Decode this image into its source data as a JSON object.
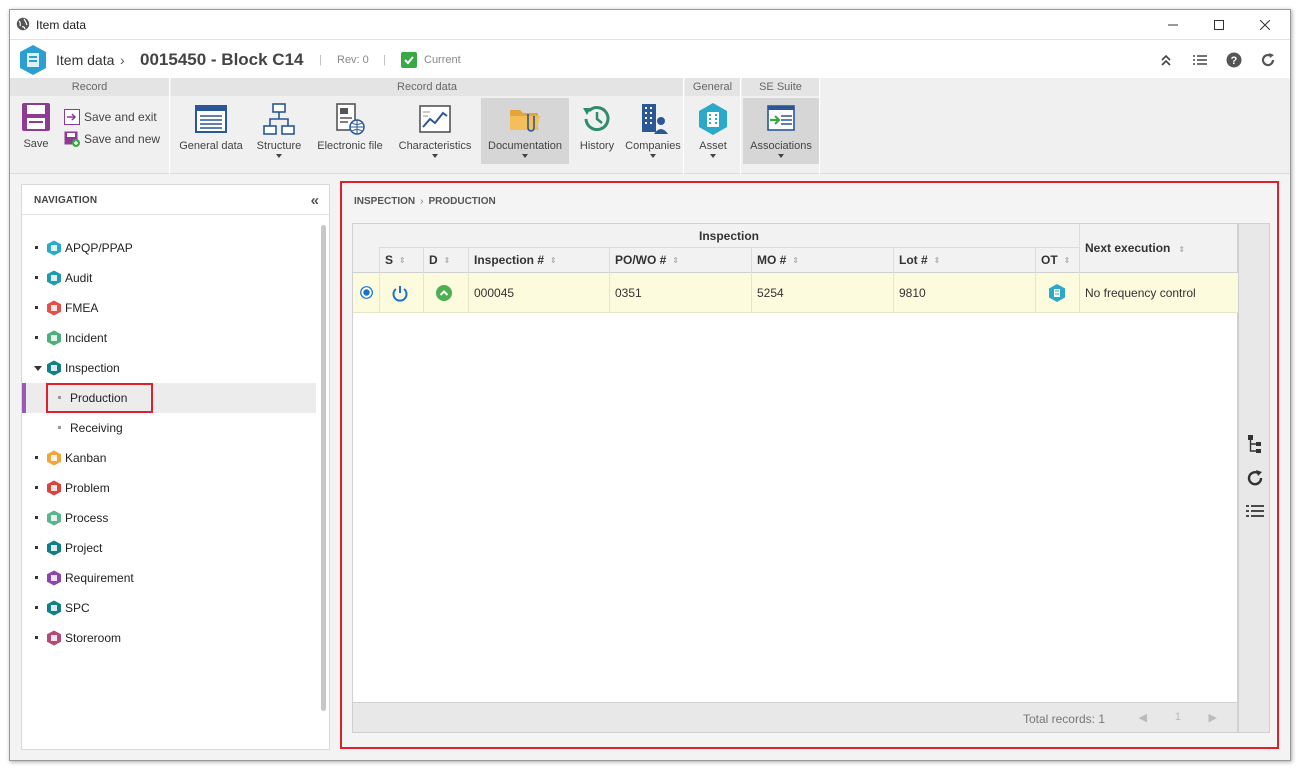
{
  "window": {
    "title": "Item data"
  },
  "header": {
    "crumb": "Item data",
    "record_title": "0015450 - Block C14",
    "separator": "|",
    "revision": "Rev: 0",
    "status": "Current"
  },
  "ribbon": {
    "groups": {
      "record": "Record",
      "record_data": "Record data",
      "general": "General",
      "se_suite": "SE Suite"
    },
    "buttons": {
      "save": "Save",
      "save_exit": "Save and exit",
      "save_new": "Save and new",
      "general_data": "General data",
      "structure": "Structure",
      "electronic_file": "Electronic file",
      "characteristics": "Characteristics",
      "documentation": "Documentation",
      "history": "History",
      "companies": "Companies",
      "asset": "Asset",
      "associations": "Associations"
    }
  },
  "navigation": {
    "title": "NAVIGATION",
    "items": [
      {
        "label": "APQP/PPAP",
        "icon": "apqp-icon",
        "color": "#2aa9c9"
      },
      {
        "label": "Audit",
        "icon": "audit-icon",
        "color": "#1f9bb0"
      },
      {
        "label": "FMEA",
        "icon": "fmea-icon",
        "color": "#e2504a"
      },
      {
        "label": "Incident",
        "icon": "incident-icon",
        "color": "#4caf7a"
      },
      {
        "label": "Inspection",
        "icon": "inspection-icon",
        "color": "#127e86"
      },
      {
        "label": "Production"
      },
      {
        "label": "Receiving"
      },
      {
        "label": "Kanban",
        "icon": "kanban-icon",
        "color": "#f0a63a"
      },
      {
        "label": "Problem",
        "icon": "problem-icon",
        "color": "#d9443c"
      },
      {
        "label": "Process",
        "icon": "process-icon",
        "color": "#5bb48f"
      },
      {
        "label": "Project",
        "icon": "project-icon",
        "color": "#137d86"
      },
      {
        "label": "Requirement",
        "icon": "requirement-icon",
        "color": "#8e44ad"
      },
      {
        "label": "SPC",
        "icon": "spc-icon",
        "color": "#127e86"
      },
      {
        "label": "Storeroom",
        "icon": "storeroom-icon",
        "color": "#b24a7a"
      }
    ]
  },
  "main": {
    "breadcrumb": [
      "INSPECTION",
      "PRODUCTION"
    ],
    "grid": {
      "group_header": "Inspection",
      "columns": {
        "s": "S",
        "d": "D",
        "inspection_no": "Inspection #",
        "po_wo": "PO/WO #",
        "mo": "MO #",
        "lot": "Lot #",
        "ot": "OT",
        "next_execution": "Next execution"
      },
      "rows": [
        {
          "inspection_no": "000045",
          "po_wo": "0351",
          "mo": "5254",
          "lot": "9810",
          "next_execution": "No frequency control"
        }
      ],
      "total_records": "Total records: 1",
      "page": "1"
    }
  },
  "colors": {
    "accent_red": "#e0202c",
    "selected_row": "#fcfbde",
    "nav_selected_bar": "#9b59b6",
    "status_green": "#3aa845"
  }
}
